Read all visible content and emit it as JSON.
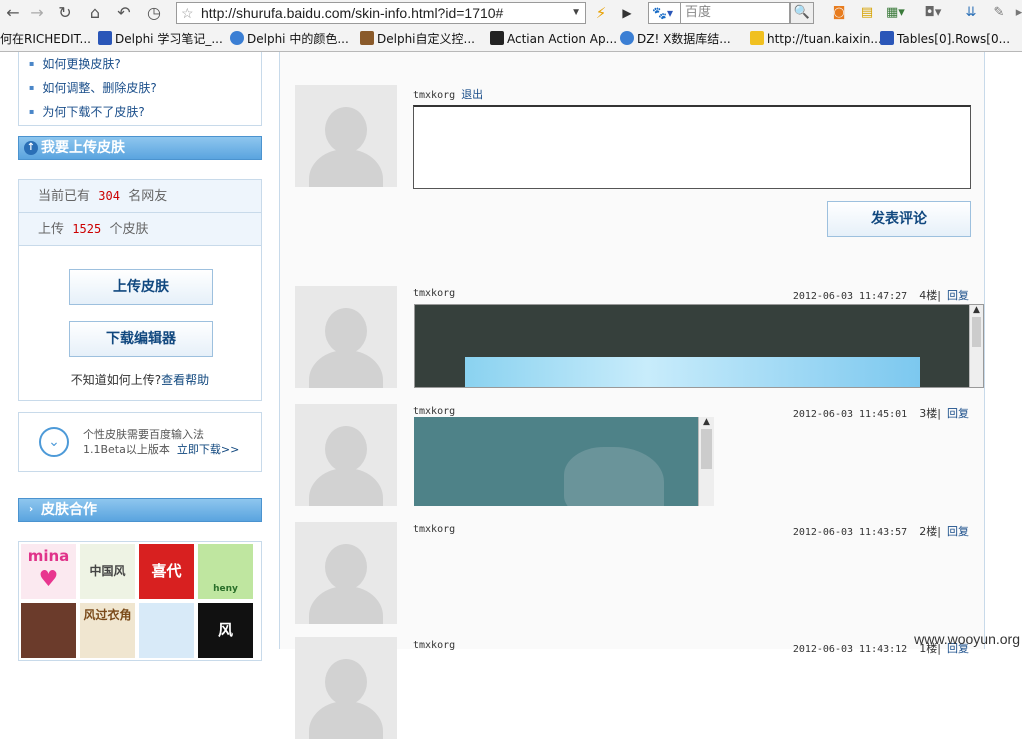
{
  "browser": {
    "url": "http://shurufa.baidu.com/skin-info.html?id=1710#",
    "search_placeholder": "百度",
    "bookmarks": [
      {
        "label": "何在RICHEDIT..."
      },
      {
        "label": "Delphi 学习笔记_..."
      },
      {
        "label": "Delphi 中的颜色..."
      },
      {
        "label": "Delphi自定义控..."
      },
      {
        "label": "Actian Action Ap..."
      },
      {
        "label": "DZ! X数据库结..."
      },
      {
        "label": "http://tuan.kaixin..."
      },
      {
        "label": "Tables[0].Rows[0..."
      }
    ]
  },
  "sidebar": {
    "help_links": [
      "如何更换皮肤?",
      "如何调整、删除皮肤?",
      "为何下载不了皮肤?"
    ],
    "upload_heading": "我要上传皮肤",
    "stats": {
      "users_prefix": "当前已有",
      "users_count": "304",
      "users_suffix": "名网友",
      "uploads_prefix": "上传",
      "uploads_count": "1525",
      "uploads_suffix": "个皮肤"
    },
    "upload_button": "上传皮肤",
    "download_editor_button": "下载编辑器",
    "hint_text": "不知道如何上传?",
    "hint_link": "查看帮助",
    "promo_line1": "个性皮肤需要百度输入法",
    "promo_line2": "1.1Beta以上版本",
    "promo_link": "立即下载>>",
    "partner_heading": "皮肤合作",
    "thumbs": [
      "mina",
      "中国风",
      "喜代",
      "heny",
      "",
      "风过衣角",
      "",
      "风"
    ]
  },
  "main": {
    "current_user": "tmxkorg",
    "logout": "退出",
    "submit_label": "发表评论",
    "comments": [
      {
        "user": "tmxkorg",
        "time": "2012-06-03 11:47:27",
        "floor": "4楼|",
        "reply": "回复"
      },
      {
        "user": "tmxkorg",
        "time": "2012-06-03 11:45:01",
        "floor": "3楼|",
        "reply": "回复"
      },
      {
        "user": "tmxkorg",
        "time": "2012-06-03 11:43:57",
        "floor": "2楼|",
        "reply": "回复"
      },
      {
        "user": "tmxkorg",
        "time": "2012-06-03 11:43:12",
        "floor": "1楼|",
        "reply": "回复"
      }
    ]
  },
  "watermark": "www.wooyun.org"
}
